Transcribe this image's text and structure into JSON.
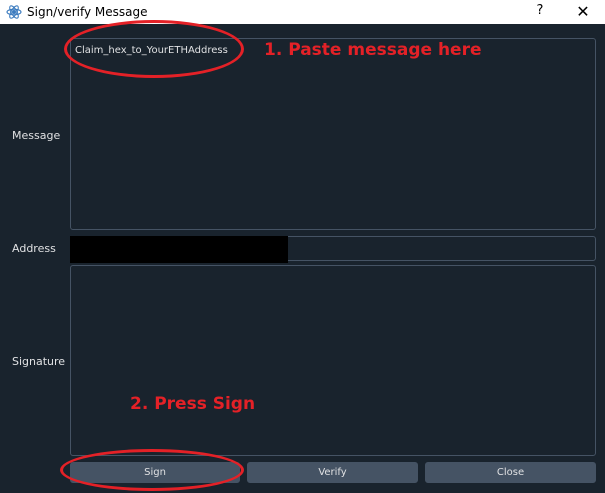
{
  "window": {
    "title": "Sign/verify Message",
    "help": "?",
    "close": "✕"
  },
  "form": {
    "message_label": "Message",
    "message_value": "Claim_hex_to_YourETHAddress",
    "address_label": "Address",
    "address_value": "",
    "signature_label": "Signature",
    "signature_value": ""
  },
  "buttons": {
    "sign": "Sign",
    "verify": "Verify",
    "close": "Close"
  },
  "annotations": {
    "step1": "1. Paste message here",
    "step2": "2. Press Sign",
    "color": "#e42127"
  },
  "theme": {
    "background": "#19232d",
    "border": "#455364",
    "text": "#e0e1e3"
  },
  "icons": {
    "app": "electrum-logo-icon"
  }
}
